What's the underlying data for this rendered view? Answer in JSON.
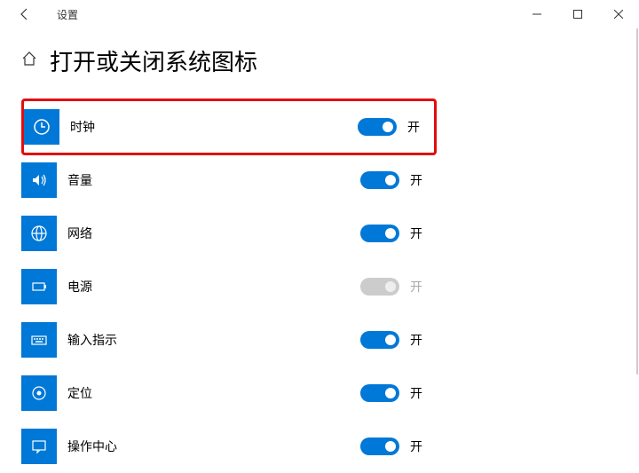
{
  "app_title": "设置",
  "page_title": "打开或关闭系统图标",
  "state_on": "开",
  "items": [
    {
      "id": "clock",
      "label": "时钟",
      "on": true,
      "disabled": false,
      "highlight": true
    },
    {
      "id": "volume",
      "label": "音量",
      "on": true,
      "disabled": false,
      "highlight": false
    },
    {
      "id": "network",
      "label": "网络",
      "on": true,
      "disabled": false,
      "highlight": false
    },
    {
      "id": "power",
      "label": "电源",
      "on": true,
      "disabled": true,
      "highlight": false
    },
    {
      "id": "input",
      "label": "输入指示",
      "on": true,
      "disabled": false,
      "highlight": false
    },
    {
      "id": "location",
      "label": "定位",
      "on": true,
      "disabled": false,
      "highlight": false
    },
    {
      "id": "action",
      "label": "操作中心",
      "on": true,
      "disabled": false,
      "highlight": false
    }
  ]
}
